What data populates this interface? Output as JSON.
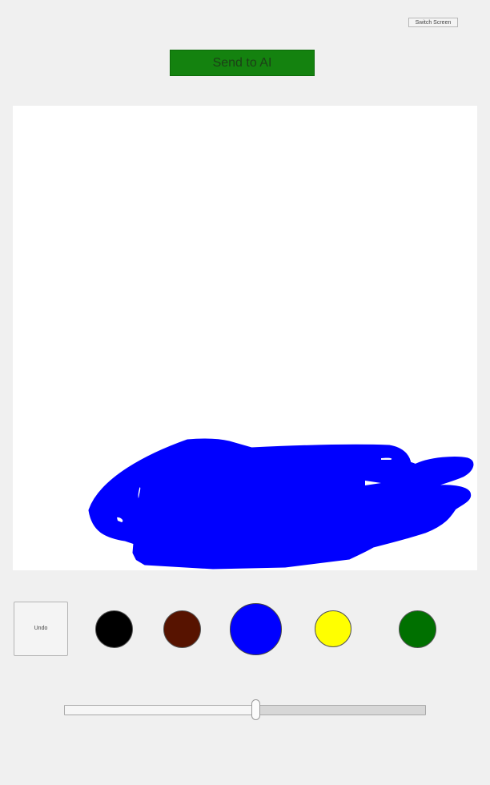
{
  "header": {
    "switch_label": "Switch Screen",
    "send_label": "Send to AI"
  },
  "colors": {
    "send_button": "#14820f",
    "stroke": "#0000ff",
    "canvas": "#ffffff",
    "background": "#f0f0f0"
  },
  "toolbar": {
    "undo_label": "Undo",
    "swatches": [
      {
        "name": "black",
        "color": "#000000",
        "selected": false
      },
      {
        "name": "brown",
        "color": "#571300",
        "selected": false
      },
      {
        "name": "blue",
        "color": "#0000ff",
        "selected": true
      },
      {
        "name": "yellow",
        "color": "#ffff00",
        "selected": false
      },
      {
        "name": "green",
        "color": "#007000",
        "selected": false
      }
    ]
  },
  "brush_size": {
    "value_fraction": 0.53
  }
}
